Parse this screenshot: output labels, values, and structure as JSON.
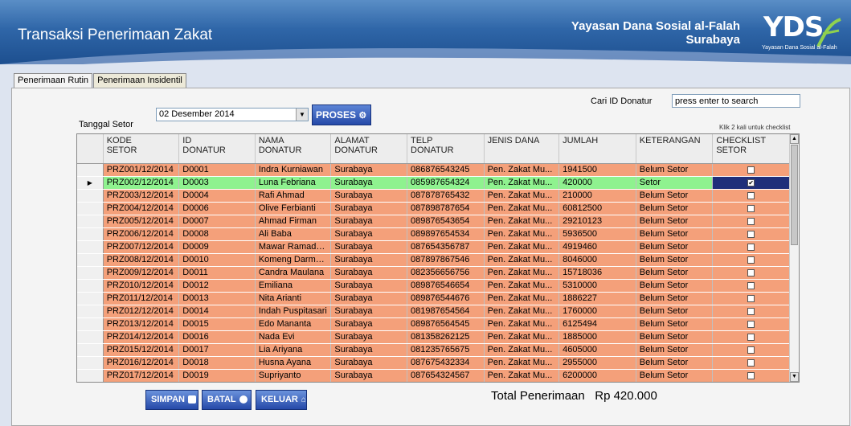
{
  "header": {
    "title": "Transaksi Penerimaan Zakat",
    "org_line1": "Yayasan Dana Sosial al-Falah",
    "org_line2": "Surabaya",
    "logo_text": "YDS",
    "logo_sub": "Yayasan Dana Sosial al-Falah"
  },
  "tabs": [
    "Penerimaan Rutin",
    "Penerimaan Insidentil"
  ],
  "form": {
    "tanggal_label": "Tanggal Setor",
    "tanggal_value": "02 Desember 2014",
    "proses_label": "PROSES",
    "cari_label": "Cari ID Donatur",
    "cari_placeholder": "press enter to search",
    "klik_note": "Klik 2 kali untuk checklist"
  },
  "columns": [
    [
      "KODE",
      "SETOR"
    ],
    [
      "ID",
      "DONATUR"
    ],
    [
      "NAMA",
      "DONATUR"
    ],
    [
      "ALAMAT",
      "DONATUR"
    ],
    [
      "TELP",
      "DONATUR"
    ],
    [
      "JENIS DANA",
      ""
    ],
    [
      "JUMLAH",
      ""
    ],
    [
      "KETERANGAN",
      ""
    ],
    [
      "CHECKLIST",
      "SETOR"
    ]
  ],
  "rows": [
    [
      "PRZ001/12/2014",
      "D0001",
      "Indra Kurniawan",
      "Surabaya",
      "086876543245",
      "Pen. Zakat Mu...",
      "1941500",
      "Belum Setor",
      false
    ],
    [
      "PRZ002/12/2014",
      "D0003",
      "Luna Febriana",
      "Surabaya",
      "085987654324",
      "Pen. Zakat Mu...",
      "420000",
      "Setor",
      true
    ],
    [
      "PRZ003/12/2014",
      "D0004",
      "Rafi Ahmad",
      "Surabaya",
      "087878765432",
      "Pen. Zakat Mu...",
      "210000",
      "Belum Setor",
      false
    ],
    [
      "PRZ004/12/2014",
      "D0006",
      "Olive Ferbianti",
      "Surabaya",
      "087898787654",
      "Pen. Zakat Mu...",
      "60812500",
      "Belum Setor",
      false
    ],
    [
      "PRZ005/12/2014",
      "D0007",
      "Ahmad Firman",
      "Surabaya",
      "089876543654",
      "Pen. Zakat Mu...",
      "29210123",
      "Belum Setor",
      false
    ],
    [
      "PRZ006/12/2014",
      "D0008",
      "Ali Baba",
      "Surabaya",
      "089897654534",
      "Pen. Zakat Mu...",
      "5936500",
      "Belum Setor",
      false
    ],
    [
      "PRZ007/12/2014",
      "D0009",
      "Mawar Ramadh...",
      "Surabaya",
      "087654356787",
      "Pen. Zakat Mu...",
      "4919460",
      "Belum Setor",
      false
    ],
    [
      "PRZ008/12/2014",
      "D0010",
      "Komeng Darma...",
      "Surabaya",
      "087897867546",
      "Pen. Zakat Mu...",
      "8046000",
      "Belum Setor",
      false
    ],
    [
      "PRZ009/12/2014",
      "D0011",
      "Candra Maulana",
      "Surabaya",
      "082356656756",
      "Pen. Zakat Mu...",
      "15718036",
      "Belum Setor",
      false
    ],
    [
      "PRZ010/12/2014",
      "D0012",
      "Emiliana",
      "Surabaya",
      "089876546654",
      "Pen. Zakat Mu...",
      "5310000",
      "Belum Setor",
      false
    ],
    [
      "PRZ011/12/2014",
      "D0013",
      "Nita Arianti",
      "Surabaya",
      "089876544676",
      "Pen. Zakat Mu...",
      "1886227",
      "Belum Setor",
      false
    ],
    [
      "PRZ012/12/2014",
      "D0014",
      "Indah Puspitasari",
      "Surabaya",
      "081987654564",
      "Pen. Zakat Mu...",
      "1760000",
      "Belum Setor",
      false
    ],
    [
      "PRZ013/12/2014",
      "D0015",
      "Edo Mananta",
      "Surabaya",
      "089876564545",
      "Pen. Zakat Mu...",
      "6125494",
      "Belum Setor",
      false
    ],
    [
      "PRZ014/12/2014",
      "D0016",
      "Nada Evi",
      "Surabaya",
      "081358262125",
      "Pen. Zakat Mu...",
      "1885000",
      "Belum Setor",
      false
    ],
    [
      "PRZ015/12/2014",
      "D0017",
      "Lia Ariyana",
      "Surabaya",
      "081235765675",
      "Pen. Zakat Mu...",
      "4605000",
      "Belum Setor",
      false
    ],
    [
      "PRZ016/12/2014",
      "D0018",
      "Husna Ayana",
      "Surabaya",
      "087675432334",
      "Pen. Zakat Mu...",
      "2955000",
      "Belum Setor",
      false
    ],
    [
      "PRZ017/12/2014",
      "D0019",
      "Supriyanto",
      "Surabaya",
      "087654324567",
      "Pen. Zakat Mu...",
      "6200000",
      "Belum Setor",
      false
    ]
  ],
  "selected_row": 1,
  "buttons": {
    "simpan": "SIMPAN",
    "batal": "BATAL",
    "keluar": "KELUAR"
  },
  "total_label": "Total Penerimaan",
  "total_value": "Rp 420.000",
  "colors": {
    "row_default": "#f4a07a",
    "row_selected": "#8ff28f",
    "header_blue": "#2f66a8",
    "button_blue": "#2549a8"
  }
}
